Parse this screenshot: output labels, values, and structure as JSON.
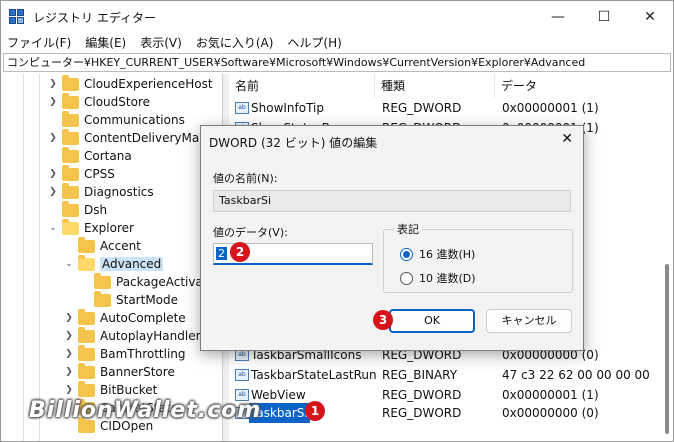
{
  "window": {
    "title": "レジストリ エディター",
    "controls": {
      "minimize": "—",
      "maximize": "☐",
      "close": "✕"
    }
  },
  "menu": [
    "ファイル(F)",
    "編集(E)",
    "表示(V)",
    "お気に入り(A)",
    "ヘルプ(H)"
  ],
  "address": "コンピューター¥HKEY_CURRENT_USER¥Software¥Microsoft¥Windows¥CurrentVersion¥Explorer¥Advanced",
  "tree": [
    {
      "label": "CloudExperienceHost",
      "expanded": false
    },
    {
      "label": "CloudStore",
      "expanded": false
    },
    {
      "label": "Communications",
      "expanded": false
    },
    {
      "label": "ContentDeliveryManager",
      "expanded": false
    },
    {
      "label": "Cortana",
      "expanded": false
    },
    {
      "label": "CPSS",
      "expanded": false
    },
    {
      "label": "Diagnostics",
      "expanded": false
    },
    {
      "label": "Dsh",
      "expanded": false
    },
    {
      "label": "Explorer",
      "expanded": true
    },
    {
      "label": "Accent",
      "expanded": false
    },
    {
      "label": "Advanced",
      "expanded": true,
      "selected": true
    },
    {
      "label": "PackageActivation",
      "expanded": false
    },
    {
      "label": "StartMode",
      "expanded": false
    },
    {
      "label": "AutoComplete",
      "expanded": false
    },
    {
      "label": "AutoplayHandlers",
      "expanded": false
    },
    {
      "label": "BamThrottling",
      "expanded": false
    },
    {
      "label": "BannerStore",
      "expanded": false
    },
    {
      "label": "BitBucket",
      "expanded": false
    },
    {
      "label": "CabinetState",
      "expanded": false
    },
    {
      "label": "CIDOpen",
      "expanded": false
    }
  ],
  "columns": {
    "name": "名前",
    "type": "種類",
    "data": "データ"
  },
  "values": [
    {
      "name": "ShowInfoTip",
      "type": "REG_DWORD",
      "data": "0x00000001 (1)"
    },
    {
      "name": "ShowStatusBar",
      "type": "REG_DWORD",
      "data": "0x00000001 (1)"
    },
    {
      "name": "TaskbarSmallIcons",
      "type": "REG_DWORD",
      "data": "0x00000000 (0)"
    },
    {
      "name": "TaskbarStateLastRun",
      "type": "REG_BINARY",
      "data": "47 c3 22 62 00 00 00 00"
    },
    {
      "name": "WebView",
      "type": "REG_DWORD",
      "data": "0x00000001 (1)"
    },
    {
      "name": "TaskbarSi",
      "type": "REG_DWORD",
      "data": "0x00000000 (0)",
      "selected": true
    }
  ],
  "value_icon": "ab",
  "dialog": {
    "title": "DWORD (32 ビット) 値の編集",
    "close": "✕",
    "name_label": "値の名前(N):",
    "name_value": "TaskbarSi",
    "data_label": "値のデータ(V):",
    "data_value": "2",
    "radix_title": "表記",
    "radix_hex": "16 進数(H)",
    "radix_dec": "10 進数(D)",
    "radix_selected": "hex",
    "ok": "OK",
    "cancel": "キャンセル"
  },
  "badges": [
    "1",
    "2",
    "3"
  ],
  "watermark": "BillionWallet.com",
  "colors": {
    "accent": "#0a64c8",
    "badge": "#d6141b",
    "folder": "#f5c44a"
  }
}
